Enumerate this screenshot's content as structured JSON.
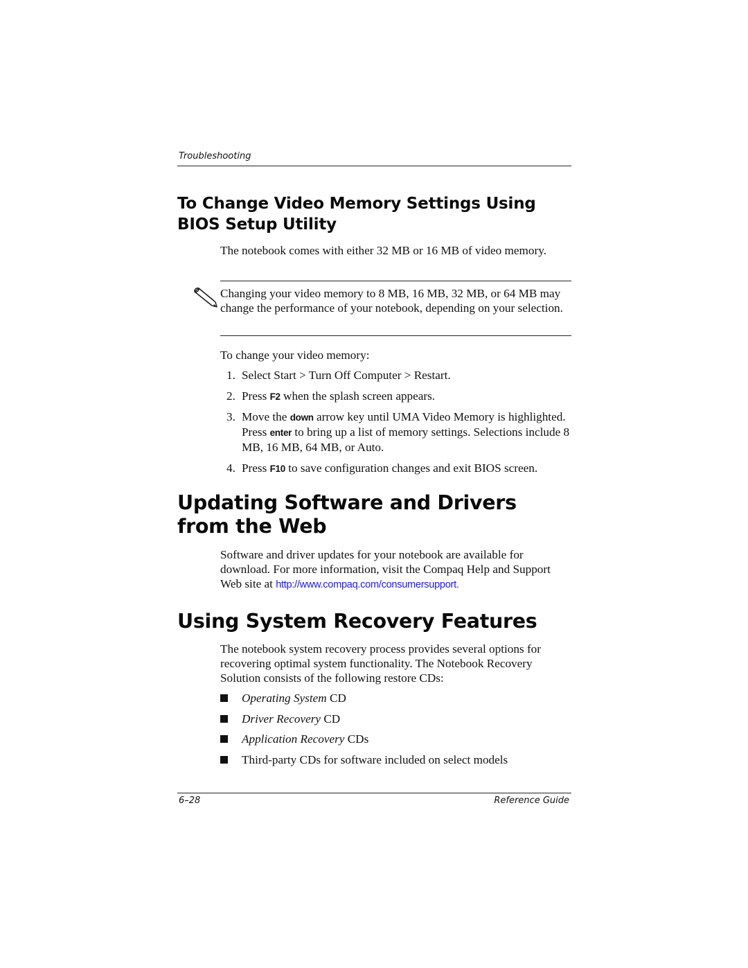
{
  "header": {
    "running_head": "Troubleshooting"
  },
  "section_video_memory": {
    "title": "To Change Video Memory Settings Using BIOS Setup Utility",
    "intro": "The notebook comes with either 32 MB or 16 MB of video memory.",
    "note": {
      "icon": "pencil-note-icon",
      "text": "Changing your video memory to 8 MB, 16 MB, 32 MB, or 64 MB may change the performance of your notebook, depending on your selection."
    },
    "lead": "To change your video memory:",
    "steps": [
      {
        "num": "1.",
        "text": "Select Start > Turn Off Computer > Restart."
      },
      {
        "num": "2.",
        "pre": "Press ",
        "key": "F2",
        "post": " when the splash screen appears."
      },
      {
        "num": "3.",
        "pre": "Move the ",
        "key": "down",
        "mid": " arrow key until UMA Video Memory is highlighted. Press ",
        "key2": "enter",
        "post": " to bring up a list of memory settings. Selections include 8 MB, 16 MB, 64 MB, or Auto."
      },
      {
        "num": "4.",
        "pre": "Press ",
        "key": "F10",
        "post": " to save configuration changes and exit BIOS screen."
      }
    ]
  },
  "section_updating": {
    "title": "Updating Software and Drivers from the Web",
    "body_pre": "Software and driver updates for your notebook are available for download. For more information, visit the Compaq Help and Support Web site at ",
    "link": "http://www.compaq.com/consumersupport.",
    "link_color": "#1a1aff"
  },
  "section_recovery": {
    "title": "Using System Recovery Features",
    "body": "The notebook system recovery process provides several options for recovering optimal system functionality. The Notebook Recovery Solution consists of the following restore CDs:",
    "bullets": [
      {
        "italic": "Operating System",
        "rest": " CD"
      },
      {
        "italic": "Driver Recovery",
        "rest": " CD"
      },
      {
        "italic": "Application Recovery",
        "rest": " CDs"
      },
      {
        "italic": "",
        "rest": "Third-party CDs for software included on select models"
      }
    ]
  },
  "footer": {
    "page_number": "6–28",
    "book_title": "Reference Guide"
  }
}
